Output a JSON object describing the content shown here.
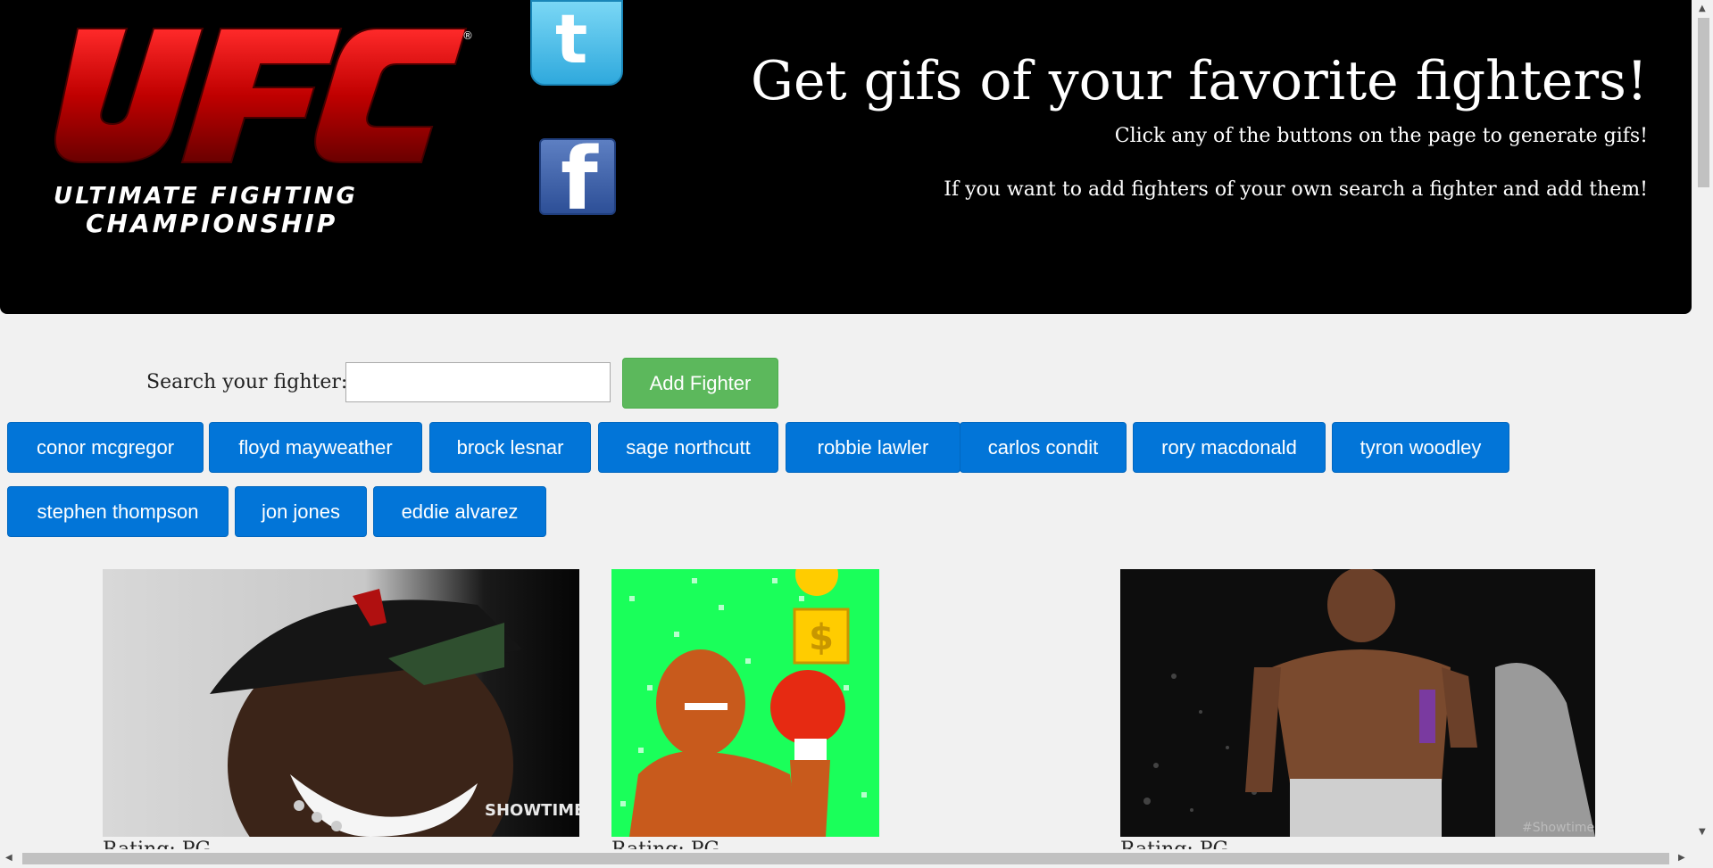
{
  "header": {
    "logo_text": "UFC",
    "logo_subtitle_1": "ULTIMATE FIGHTING",
    "logo_subtitle_2": "CHAMPIONSHIP",
    "headline": "Get gifs of your favorite fighters!",
    "subtitle_1": "Click any of the buttons on the page to generate gifs!",
    "subtitle_2": "If you want to add fighters of your own search a fighter and add them!"
  },
  "search": {
    "label": "Search your fighter:",
    "input_value": "",
    "add_button": "Add Fighter"
  },
  "fighters": [
    "conor mcgregor",
    "floyd mayweather",
    "brock lesnar",
    "sage northcutt",
    "robbie lawler",
    "carlos condit",
    "rory macdonald",
    "tyron woodley",
    "stephen thompson",
    "jon jones",
    "eddie alvarez"
  ],
  "gifs": [
    {
      "watermark": "SHOWTIME",
      "caption": "Rating: PG"
    },
    {
      "watermark": "",
      "caption": "Rating: PG"
    },
    {
      "watermark": "#Showtime",
      "caption": "Rating: PG"
    }
  ],
  "colors": {
    "header_bg": "#000000",
    "primary_button": "#0275d8",
    "success_button": "#5cb85c",
    "page_bg": "#f1f1f1"
  }
}
